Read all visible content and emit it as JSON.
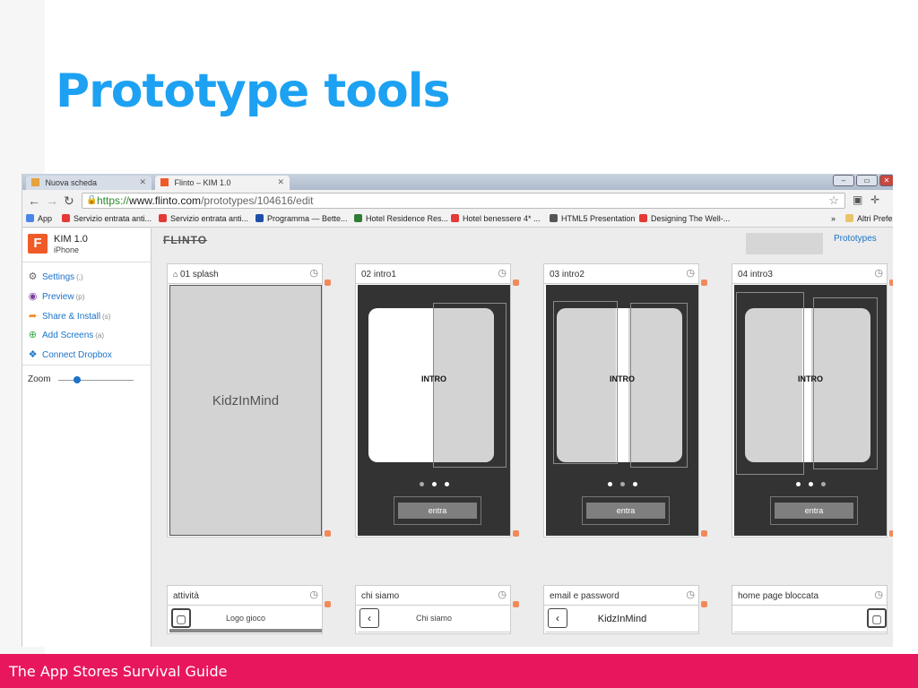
{
  "slide": {
    "title": "Prototype tools",
    "footer": "The App Stores Survival Guide",
    "accent_color": "#1da1f2",
    "footer_color": "#e8175d"
  },
  "browser": {
    "tabs": [
      {
        "label": "Nuova scheda",
        "active": false
      },
      {
        "label": "Flinto – KIM 1.0",
        "active": true
      }
    ],
    "url_scheme": "https://",
    "url_host": "www.flinto.com",
    "url_path": "/prototypes/104616/edit",
    "bookmarks": [
      {
        "label": "App",
        "icon": "apps-grid-icon"
      },
      {
        "label": "Servizio entrata anti...",
        "icon": "bookmark-icon"
      },
      {
        "label": "Servizio entrata anti...",
        "icon": "bookmark-icon"
      },
      {
        "label": "Programma — Bette...",
        "icon": "bookmark-icon"
      },
      {
        "label": "Hotel Residence Res...",
        "icon": "bookmark-icon"
      },
      {
        "label": "Hotel benessere 4* ...",
        "icon": "bookmark-icon"
      },
      {
        "label": "HTML5 Presentation",
        "icon": "bookmark-icon"
      },
      {
        "label": "Designing The Well-...",
        "icon": "bookmark-icon"
      }
    ],
    "bookmarks_more": "»",
    "other_bookmarks": "Altri Prefe"
  },
  "flinto": {
    "project_name": "KIM 1.0",
    "project_device": "iPhone",
    "menu": [
      {
        "label": "Settings",
        "key": "(,)",
        "icon": "gear-icon"
      },
      {
        "label": "Preview",
        "key": "(p)",
        "icon": "eye-icon"
      },
      {
        "label": "Share & Install",
        "key": "(s)",
        "icon": "share-arrow-icon"
      },
      {
        "label": "Add Screens",
        "key": "(a)",
        "icon": "plus-circle-icon"
      },
      {
        "label": "Connect Dropbox",
        "key": "",
        "icon": "dropbox-icon"
      }
    ],
    "zoom_label": "Zoom",
    "zoom_level": 0.25,
    "logo_text": "FLINTO",
    "prototypes_link": "Prototypes",
    "screens": [
      {
        "title": "01 splash",
        "body_text": "KidzInMind"
      },
      {
        "title": "02 intro1",
        "body_text": "INTRO",
        "button": "entra"
      },
      {
        "title": "03 intro2",
        "body_text": "INTRO",
        "button": "entra"
      },
      {
        "title": "04 intro3",
        "body_text": "INTRO",
        "button": "entra"
      }
    ],
    "screens_row2": [
      {
        "title": "attività",
        "body_text": "Logo gioco"
      },
      {
        "title": "chi siamo",
        "body_text": "Chi siamo"
      },
      {
        "title": "email e password",
        "body_text": "KidzInMind"
      },
      {
        "title": "home page bloccata",
        "body_text": ""
      }
    ]
  }
}
